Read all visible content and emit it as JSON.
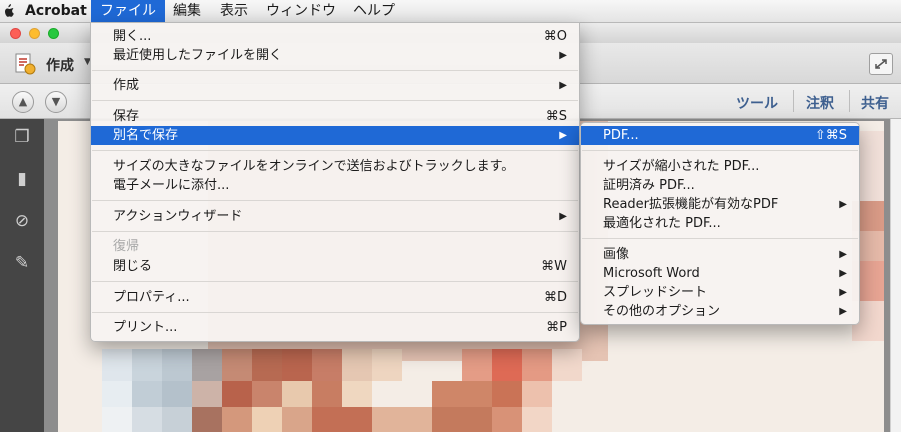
{
  "menubar": {
    "apple": "",
    "app_name": "Acrobat",
    "items": [
      "ファイル",
      "編集",
      "表示",
      "ウィンドウ",
      "ヘルプ"
    ],
    "active_index": 0
  },
  "toolbar": {
    "create_label": "作成",
    "right_buttons": [
      "ツール",
      "注釈",
      "共有"
    ]
  },
  "file_menu": {
    "open": {
      "label": "開く...",
      "shortcut": "⌘O"
    },
    "recent": {
      "label": "最近使用したファイルを開く"
    },
    "create": {
      "label": "作成"
    },
    "save": {
      "label": "保存",
      "shortcut": "⌘S"
    },
    "save_as": {
      "label": "別名で保存"
    },
    "send_large": {
      "label": "サイズの大きなファイルをオンラインで送信およびトラックします。"
    },
    "attach_email": {
      "label": "電子メールに添付..."
    },
    "action_wizard": {
      "label": "アクションウィザード"
    },
    "revert": {
      "label": "復帰"
    },
    "close": {
      "label": "閉じる",
      "shortcut": "⌘W"
    },
    "properties": {
      "label": "プロパティ...",
      "shortcut": "⌘D"
    },
    "print": {
      "label": "プリント...",
      "shortcut": "⌘P"
    },
    "submenu_arrow": "▶"
  },
  "save_as_submenu": {
    "pdf": {
      "label": "PDF...",
      "shortcut": "⇧⌘S"
    },
    "reduced": {
      "label": "サイズが縮小された PDF..."
    },
    "certified": {
      "label": "証明済み PDF..."
    },
    "reader_extended": {
      "label": "Reader拡張機能が有効なPDF"
    },
    "optimized": {
      "label": "最適化された PDF..."
    },
    "image": {
      "label": "画像"
    },
    "word": {
      "label": "Microsoft Word"
    },
    "spreadsheet": {
      "label": "スプレッドシート"
    },
    "other": {
      "label": "その他のオプション"
    }
  },
  "colors": {
    "highlight": "#1f69d6",
    "menu_bg": "#f6f3f1"
  }
}
